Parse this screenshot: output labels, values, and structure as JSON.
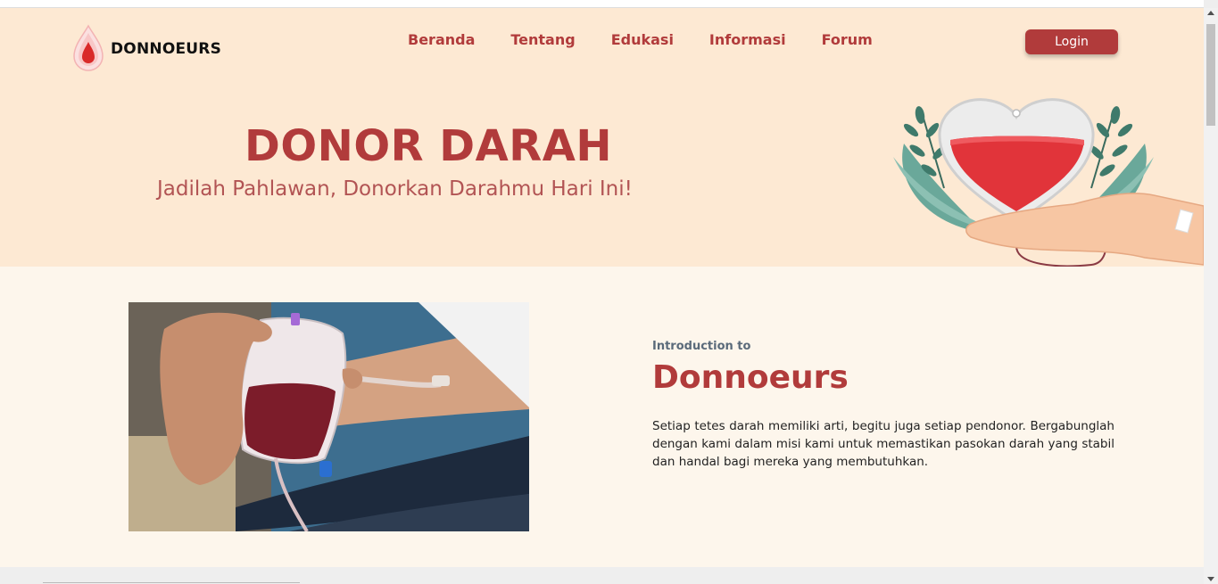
{
  "brand": {
    "name": "DONNOEURS",
    "logo_icon": "blood-drop-icon"
  },
  "nav": {
    "items": [
      {
        "label": "Beranda"
      },
      {
        "label": "Tentang"
      },
      {
        "label": "Edukasi"
      },
      {
        "label": "Informasi"
      },
      {
        "label": "Forum"
      }
    ],
    "login_label": "Login"
  },
  "hero": {
    "title": "DONOR DARAH",
    "subtitle": "Jadilah Pahlawan, Donorkan Darahmu Hari Ini!",
    "illustration": "blood-bag-heart-hand-illustration"
  },
  "intro": {
    "eyebrow": "Introduction to",
    "title": "Donnoeurs",
    "body": "Setiap tetes darah memiliki arti, begitu juga setiap pendonor. Bergabunglah dengan kami dalam misi kami untuk memastikan pasokan darah yang stabil dan handal bagi mereka yang membutuhkan.",
    "photo": "blood-donation-bag-photo"
  },
  "colors": {
    "accent": "#b13b3b",
    "hero_bg": "#fde9d3",
    "section_bg": "#fdf6ec"
  }
}
